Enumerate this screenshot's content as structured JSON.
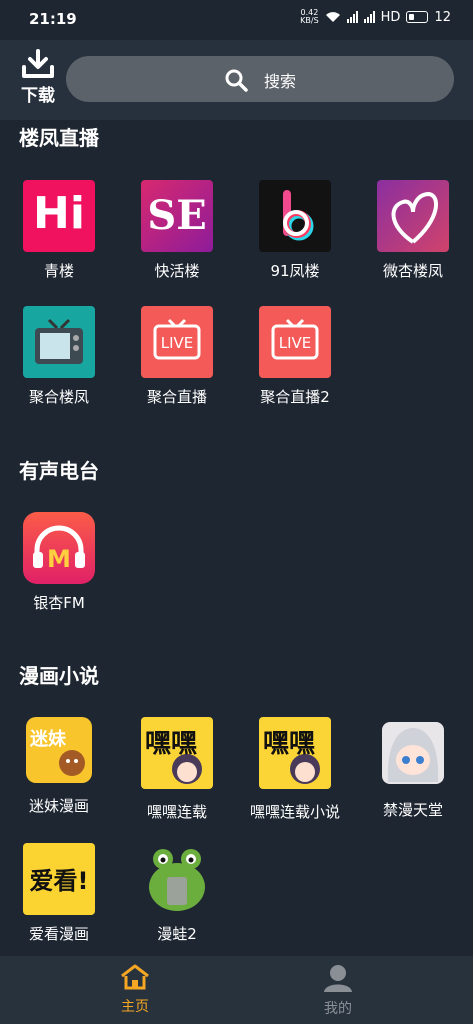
{
  "status_bar": {
    "time": "21:19",
    "net_speed_top": "0.42",
    "net_speed_bottom": "KB/S",
    "network_type": "HD",
    "battery": "12"
  },
  "header": {
    "download_label": "下载",
    "search_placeholder": "搜索"
  },
  "sections": [
    {
      "title": "楼凤直播",
      "apps": [
        {
          "name": "青楼",
          "icon": "hi-logo-icon"
        },
        {
          "name": "快活楼",
          "icon": "se-logo-icon"
        },
        {
          "name": "91凤楼",
          "icon": "b-logo-icon"
        },
        {
          "name": "微杏楼凤",
          "icon": "heart-logo-icon"
        },
        {
          "name": "聚合楼凤",
          "icon": "tv-icon"
        },
        {
          "name": "聚合直播",
          "icon": "live-tv-icon"
        },
        {
          "name": "聚合直播2",
          "icon": "live-tv-icon"
        }
      ]
    },
    {
      "title": "有声电台",
      "apps": [
        {
          "name": "银杏FM",
          "icon": "headphones-icon"
        }
      ]
    },
    {
      "title": "漫画小说",
      "apps": [
        {
          "name": "迷妹漫画",
          "icon": "mimei-logo-icon"
        },
        {
          "name": "嘿嘿连载",
          "icon": "heihei-logo-icon"
        },
        {
          "name": "嘿嘿连载小说",
          "icon": "heihei-logo-icon"
        },
        {
          "name": "禁漫天堂",
          "icon": "anime-girl-icon"
        },
        {
          "name": "爱看漫画",
          "icon": "aikan-logo-icon"
        },
        {
          "name": "漫蛙2",
          "icon": "frog-icon"
        }
      ]
    }
  ],
  "icon_text": {
    "hi": "Hi",
    "se": "SE",
    "live": "LIVE",
    "mimei": "迷妹",
    "heihei": "嘿嘿",
    "aikan": "爱看!",
    "fm_m": "M"
  },
  "bottom_nav": {
    "home_label": "主页",
    "mine_label": "我的",
    "active_color": "#f5a623",
    "inactive_color": "#8a8f96"
  }
}
